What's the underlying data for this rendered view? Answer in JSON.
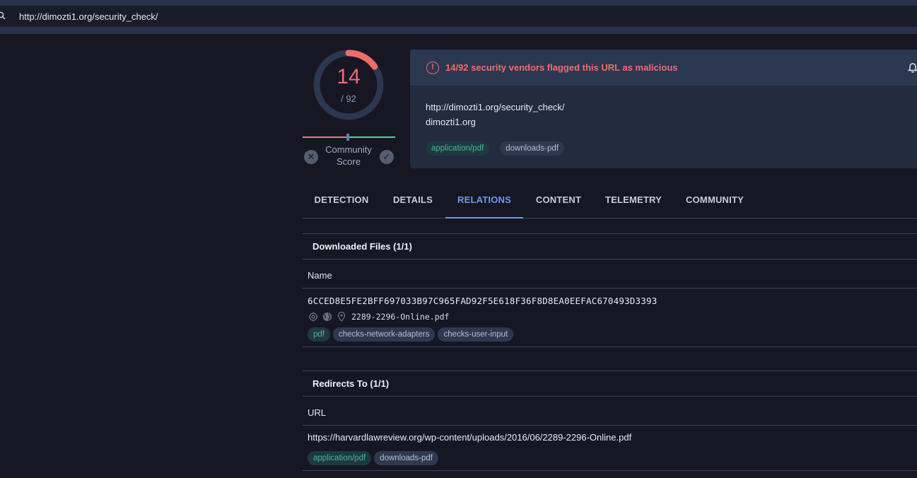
{
  "address_bar": {
    "url": "http://dimozti1.org/security_check/"
  },
  "score": {
    "detections": "14",
    "total": "/ 92",
    "detection_fraction": 0.152,
    "community_label_line1": "Community",
    "community_label_line2": "Score",
    "community_position": 0.5
  },
  "detection_card": {
    "alert_text": "14/92 security vendors flagged this URL as malicious",
    "url": "http://dimozti1.org/security_check/",
    "domain": "dimozti1.org",
    "tags": [
      "application/pdf",
      "downloads-pdf"
    ]
  },
  "tabs": [
    {
      "label": "DETECTION"
    },
    {
      "label": "DETAILS"
    },
    {
      "label": "RELATIONS"
    },
    {
      "label": "CONTENT"
    },
    {
      "label": "TELEMETRY"
    },
    {
      "label": "COMMUNITY"
    }
  ],
  "active_tab": "RELATIONS",
  "downloaded_files": {
    "title": "Downloaded Files (1/1)",
    "column": "Name",
    "rows": [
      {
        "hash": "6CCED8E5FE2BFF697033B97C965FAD92F5E618F36F8D8EA0EEFAC670493D3393",
        "filename": "2289-2296-Online.pdf",
        "tags": [
          "pdf",
          "checks-network-adapters",
          "checks-user-input"
        ]
      }
    ]
  },
  "redirects_to": {
    "title": "Redirects To (1/1)",
    "column": "URL",
    "rows": [
      {
        "url": "https://harvardlawreview.org/wp-content/uploads/2016/06/2289-2296-Online.pdf",
        "tags": [
          "application/pdf",
          "downloads-pdf"
        ]
      }
    ]
  },
  "colors": {
    "malicious": "#f06c6c",
    "accent": "#6e97f0",
    "background": "#171724",
    "card": "#232b3f"
  }
}
